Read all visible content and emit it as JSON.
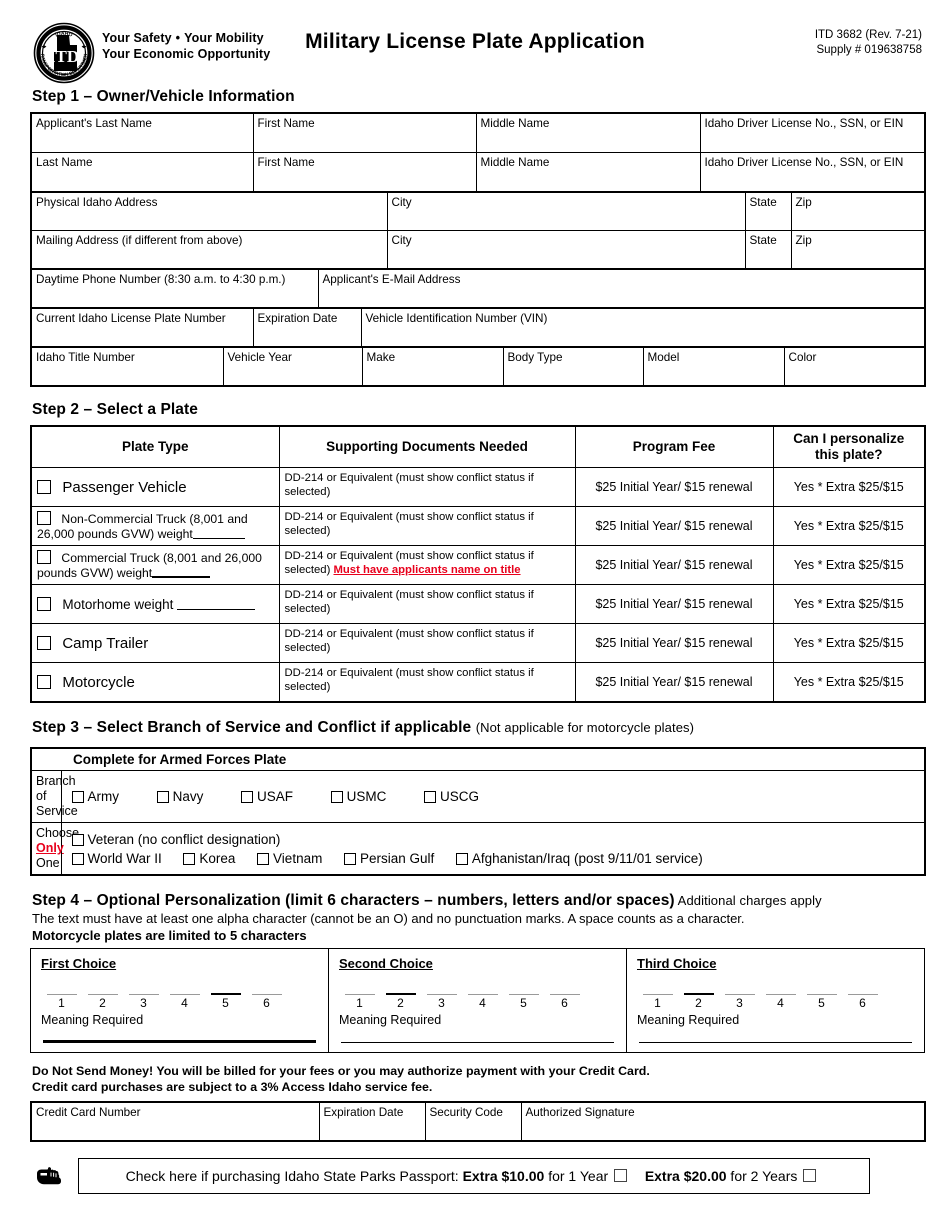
{
  "header": {
    "logo_icon": "idaho-transportation-department-seal",
    "tagline_line1_a": "Your Safety",
    "tagline_dot": "•",
    "tagline_line1_b": "Your Mobility",
    "tagline_line2": "Your Economic Opportunity",
    "title": "Military License Plate Application",
    "form_number": "ITD 3682  (Rev. 7-21)",
    "supply_number": "Supply # 019638758"
  },
  "step1": {
    "heading": "Step 1 – Owner/Vehicle Information",
    "row1": [
      "Applicant's Last Name",
      "First Name",
      "Middle Name",
      "Idaho Driver License No., SSN, or EIN"
    ],
    "row2": [
      "Last Name",
      "First Name",
      "Middle Name",
      "Idaho Driver License No., SSN, or EIN"
    ],
    "row3": [
      "Physical Idaho Address",
      "City",
      "State",
      "Zip"
    ],
    "row4": [
      "Mailing Address (if different from above)",
      "City",
      "State",
      "Zip"
    ],
    "row5": [
      "Daytime Phone Number (8:30 a.m. to 4:30 p.m.)",
      "Applicant's E-Mail Address"
    ],
    "row6": [
      "Current Idaho License Plate Number",
      "Expiration Date",
      "Vehicle Identification Number (VIN)"
    ],
    "row7": [
      "Idaho Title Number",
      "Vehicle Year",
      "Make",
      "Body Type",
      "Model",
      "Color"
    ]
  },
  "step2": {
    "heading": "Step 2 – Select a Plate",
    "columns": [
      "Plate Type",
      "Supporting Documents Needed",
      "Program Fee",
      "Can I personalize this plate?"
    ],
    "col4_line1": "Can I personalize",
    "col4_line2": "this plate?",
    "docs_default": "DD-214 or Equivalent (must show conflict status if selected)",
    "fee_default": "$25 Initial Year/ $15 renewal",
    "personalize_default": "Yes * Extra $25/$15",
    "rows": [
      {
        "label": "Passenger Vehicle",
        "size": "large",
        "docs": "DD-214 or Equivalent (must show conflict status if selected)",
        "docs_red": "",
        "fee": "$25 Initial Year/ $15 renewal",
        "personalize": "Yes * Extra $25/$15"
      },
      {
        "label": "Non-Commercial Truck (8,001 and 26,000 pounds GVW) weight",
        "size": "small",
        "has_blank": true,
        "docs": "DD-214 or Equivalent (must show conflict status if selected)",
        "docs_red": "",
        "fee": "$25 Initial Year/ $15 renewal",
        "personalize": "Yes * Extra $25/$15"
      },
      {
        "label": "Commercial Truck (8,001 and 26,000 pounds GVW) weight",
        "size": "small",
        "has_blank": true,
        "docs": "DD-214 or Equivalent (must show conflict status if selected)",
        "docs_red": "Must have applicants name on title",
        "fee": "$25 Initial Year/ $15 renewal",
        "personalize": "Yes * Extra $25/$15"
      },
      {
        "label": "Motorhome  weight",
        "size": "medium",
        "has_blank": true,
        "docs": "DD-214 or Equivalent (must show conflict status if selected)",
        "docs_red": "",
        "fee": "$25 Initial Year/ $15 renewal",
        "personalize": "Yes * Extra $25/$15"
      },
      {
        "label": "Camp Trailer",
        "size": "large",
        "docs": "DD-214 or Equivalent (must show conflict status if selected)",
        "docs_red": "",
        "fee": "$25 Initial Year/ $15 renewal",
        "personalize": "Yes * Extra $25/$15"
      },
      {
        "label": "Motorcycle",
        "size": "large",
        "docs": "DD-214 or Equivalent (must show conflict status if selected)",
        "docs_red": "",
        "fee": "$25 Initial Year/ $15 renewal",
        "personalize": "Yes * Extra $25/$15"
      }
    ]
  },
  "step3": {
    "heading_bold": "Step 3 – Select Branch of Service and Conflict if applicable",
    "heading_light": "(Not applicable for motorcycle plates)",
    "table_title": "Complete for Armed Forces Plate",
    "branch_label_line1": "Branch of",
    "branch_label_line2": "Service",
    "choose_line1": "Choose",
    "choose_only": "Only",
    "choose_one": " One",
    "branches": [
      "Army",
      "Navy",
      "USAF",
      "USMC",
      "USCG"
    ],
    "veteran": "Veteran (no conflict designation)",
    "conflicts": [
      "World War II",
      "Korea",
      "Vietnam",
      "Persian Gulf",
      "Afghanistan/Iraq (post 9/11/01 service)"
    ]
  },
  "step4": {
    "heading_bold": "Step 4 – Optional Personalization (limit 6 characters – numbers, letters and/or spaces)",
    "heading_light": " Additional charges apply",
    "note": "The text must have at least one alpha character (cannot be an O) and no punctuation marks. A space counts as a character.",
    "note_bold": "Motorcycle plates are limited to 5 characters",
    "meaning_label": "Meaning Required",
    "slot_numbers": [
      "1",
      "2",
      "3",
      "4",
      "5",
      "6"
    ],
    "choices": [
      {
        "title": "First Choice"
      },
      {
        "title": "Second Choice"
      },
      {
        "title": "Third Choice"
      }
    ]
  },
  "payment": {
    "note_line1": "Do Not Send Money!  You will be billed for your fees or you may authorize payment with your Credit Card.",
    "note_line2": "Credit card purchases are subject to a 3% Access Idaho service fee.",
    "columns": [
      "Credit Card Number",
      "Expiration Date",
      "Security Code",
      "Authorized Signature"
    ]
  },
  "passport": {
    "hand_icon": "pointing-hand-icon",
    "text_prefix": "Check here if purchasing Idaho State Parks Passport: ",
    "option1_amount": "Extra $10.00",
    "option1_suffix": " for 1 Year",
    "option2_amount": "Extra $20.00",
    "option2_suffix": " for 2 Years"
  },
  "colors": {
    "red": "#e8001c",
    "ink": "#000000",
    "paper": "#ffffff"
  }
}
